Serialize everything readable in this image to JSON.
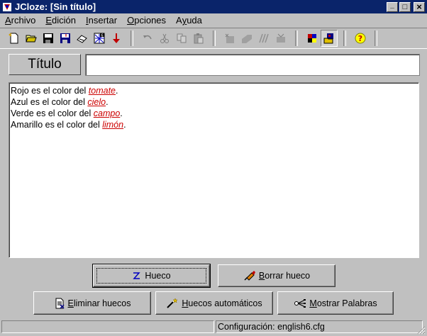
{
  "window": {
    "app_name": "JCloze:",
    "doc_title": "[Sin título]",
    "controls": {
      "minimize": "_",
      "maximize": "□",
      "close": "×"
    }
  },
  "menu": {
    "items": [
      {
        "underline": "A",
        "rest": "rchivo"
      },
      {
        "underline": "E",
        "rest": "dición"
      },
      {
        "underline": "I",
        "rest": "nsertar"
      },
      {
        "underline": "O",
        "rest": "pciones"
      },
      {
        "underline": "y",
        "rest": "uda",
        "prefix": "A"
      }
    ]
  },
  "toolbar": {
    "icons": [
      "new-file-icon",
      "open-folder-icon",
      "save-icon",
      "save-as-icon",
      "eraser-icon",
      "web-page-icon",
      "arrow-down-icon",
      "undo-icon",
      "cut-icon",
      "copy-icon",
      "paste-icon",
      "gap-tool-1-icon",
      "gap-tool-2-icon",
      "gap-tool-3-icon",
      "gap-tool-4-icon",
      "palette-icon",
      "view-mode-icon",
      "help-icon"
    ],
    "help_glyph": "?"
  },
  "title_field": {
    "label": "Título",
    "value": "",
    "placeholder": ""
  },
  "editor": {
    "lines": [
      {
        "before": "Rojo es el color del ",
        "gap": "tomate",
        "after": "."
      },
      {
        "before": "Azul es el color del ",
        "gap": "cielo",
        "after": "."
      },
      {
        "before": "Verde es el color del ",
        "gap": "campo",
        "after": "."
      },
      {
        "before": "Amarillo es el color del ",
        "gap": "limón",
        "after": "."
      }
    ]
  },
  "buttons": {
    "hueco": "Hueco",
    "borrar_underline": "B",
    "borrar_rest": "orrar hueco",
    "eliminar_underline": "E",
    "eliminar_rest": "liminar huecos",
    "automaticos_underline": "H",
    "automaticos_rest": "uecos automáticos",
    "mostrar_underline": "M",
    "mostrar_rest": "ostrar Palabras"
  },
  "status": {
    "config": "Configuración: english6.cfg"
  },
  "colors": {
    "titlebar": "#0a246a",
    "face": "#c0c0c0",
    "gap_text": "#cc0000"
  }
}
